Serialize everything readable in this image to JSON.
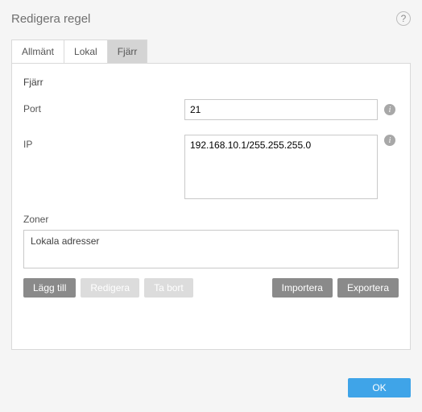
{
  "dialog": {
    "title": "Redigera regel"
  },
  "tabs": {
    "general": "Allmänt",
    "local": "Lokal",
    "remote": "Fjärr"
  },
  "remote": {
    "section_title": "Fjärr",
    "port_label": "Port",
    "port_value": "21",
    "ip_label": "IP",
    "ip_value": "192.168.10.1/255.255.255.0"
  },
  "zones": {
    "label": "Zoner",
    "items": [
      "Lokala adresser"
    ]
  },
  "buttons": {
    "add": "Lägg till",
    "edit": "Redigera",
    "delete": "Ta bort",
    "import": "Importera",
    "export": "Exportera",
    "ok": "OK"
  }
}
